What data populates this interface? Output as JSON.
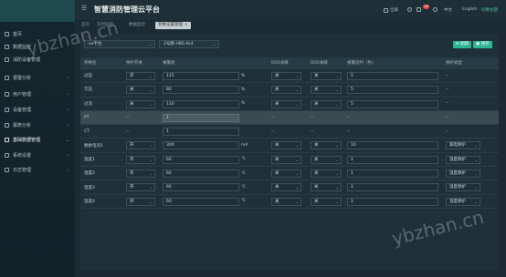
{
  "header": {
    "title": "智慧消防管理云平台",
    "fullscreen": "全屏",
    "notify_count": "20",
    "lang": "中文",
    "english": "English",
    "switch_theme": "切换主题"
  },
  "sidebar": {
    "items": [
      {
        "label": "首页",
        "icon": "home-icon",
        "arrow": ""
      },
      {
        "label": "数据监控",
        "icon": "monitor-icon",
        "arrow": ""
      },
      {
        "label": "消防设备管理",
        "icon": "device-icon",
        "arrow": ""
      },
      {
        "label": "报警分析",
        "icon": "alarm-icon",
        "arrow": "›"
      },
      {
        "label": "用户管理",
        "icon": "user-icon",
        "arrow": "›"
      },
      {
        "label": "设备管理",
        "icon": "equipment-icon",
        "arrow": "›"
      },
      {
        "label": "报表分析",
        "icon": "report-icon",
        "arrow": "›"
      },
      {
        "label": "基础数据管理",
        "icon": "database-icon",
        "arrow": "⌄",
        "active": true
      },
      {
        "label": "系统设置",
        "icon": "settings-icon",
        "arrow": "›"
      },
      {
        "label": "日志管理",
        "icon": "log-icon",
        "arrow": "›"
      }
    ]
  },
  "tabs": [
    {
      "label": "首页"
    },
    {
      "label": "实时监控"
    },
    {
      "label": "数据监控"
    },
    {
      "label": "参数设置管理",
      "active": true,
      "close": "×"
    }
  ],
  "toolbar": {
    "project_select": "xx平台",
    "device_select": "2号路-HBS-AL4",
    "refresh_label": "刷新",
    "save_label": "保存"
  },
  "table": {
    "headers": [
      "参数名",
      "保护开关",
      "报警值",
      "",
      "DO1关联",
      "DO2关联",
      "报警延时（秒）",
      "保护类型"
    ],
    "rows": [
      {
        "name": "过压",
        "switch": "开",
        "value": "115",
        "unit": "%",
        "do1": "关",
        "do2": "关",
        "delay": "5",
        "ptype": "--"
      },
      {
        "name": "欠压",
        "switch": "关",
        "value": "80",
        "unit": "%",
        "do1": "关",
        "do2": "关",
        "delay": "5",
        "ptype": "--"
      },
      {
        "name": "过流",
        "switch": "关",
        "value": "110",
        "unit": "%",
        "do1": "关",
        "do2": "关",
        "delay": "5",
        "ptype": "--"
      },
      {
        "name": "PT",
        "switch": "--",
        "value": "1",
        "unit": "",
        "do1": "--",
        "do2": "--",
        "delay": "--",
        "ptype": "--",
        "hl": true
      },
      {
        "name": "CT",
        "switch": "--",
        "value": "1",
        "unit": "",
        "do1": "--",
        "do2": "--",
        "delay": "--",
        "ptype": "--"
      },
      {
        "name": "剩余电流1",
        "switch": "开",
        "value": "300",
        "unit": "mA",
        "do1": "关",
        "do2": "关",
        "delay": "10",
        "ptype": "漏电保护"
      },
      {
        "name": "温度1",
        "switch": "开",
        "value": "60",
        "unit": "℃",
        "do1": "关",
        "do2": "关",
        "delay": "1",
        "ptype": "温度保护"
      },
      {
        "name": "温度2",
        "switch": "开",
        "value": "60",
        "unit": "℃",
        "do1": "关",
        "do2": "关",
        "delay": "1",
        "ptype": "温度保护"
      },
      {
        "name": "温度3",
        "switch": "开",
        "value": "60",
        "unit": "℃",
        "do1": "关",
        "do2": "关",
        "delay": "1",
        "ptype": "温度保护"
      },
      {
        "name": "温度4",
        "switch": "开",
        "value": "60",
        "unit": "℃",
        "do1": "关",
        "do2": "关",
        "delay": "1",
        "ptype": "温度保护"
      }
    ]
  },
  "watermark": "ybzhan.cn",
  "colors": {
    "accent": "#2bb592",
    "sidebar_header": "#1e4a4f",
    "badge": "#e24646"
  }
}
